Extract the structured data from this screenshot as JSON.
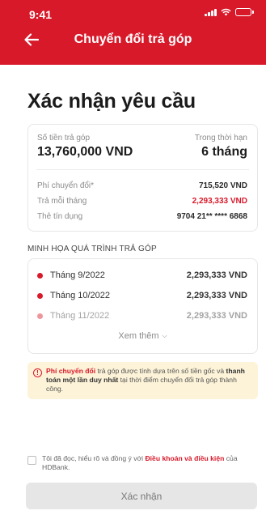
{
  "status_bar": {
    "time": "9:41"
  },
  "header": {
    "title": "Chuyển đổi trả góp"
  },
  "page_title": "Xác nhận yêu cầu",
  "summary": {
    "amount_label": "Số tiền trả góp",
    "amount_value": "13,760,000 VND",
    "term_label": "Trong thời hạn",
    "term_value": "6 tháng",
    "rows": [
      {
        "label": "Phí chuyển đổi*",
        "value": "715,520 VND",
        "highlight": false
      },
      {
        "label": "Trả mỗi tháng",
        "value": "2,293,333 VND",
        "highlight": true
      },
      {
        "label": "Thẻ tín dụng",
        "value": "9704 21** **** 6868",
        "highlight": false
      }
    ]
  },
  "plan": {
    "section_title": "MINH HỌA QUÁ TRÌNH TRẢ GÓP",
    "items": [
      {
        "month": "Tháng 9/2022",
        "amount": "2,293,333 VND"
      },
      {
        "month": "Tháng 10/2022",
        "amount": "2,293,333 VND"
      },
      {
        "month": "Tháng 11/2022",
        "amount": "2,293,333 VND"
      }
    ],
    "see_more": "Xem thêm"
  },
  "notice": {
    "bold1": "Phí chuyển đổi",
    "text1": " trả góp được tính dựa trên số tiền gốc và ",
    "bold2": "thanh toán một lần duy nhất",
    "text2": " tại thời điểm chuyển đổi trả góp thành công."
  },
  "agreement": {
    "prefix": "Tôi đã đọc, hiểu rõ và đồng ý với ",
    "link": "Điều khoản và điều kiện",
    "suffix": " của HDBank."
  },
  "confirm_label": "Xác nhận",
  "colors": {
    "brand": "#d8192a",
    "notice_bg": "#fdf3d8",
    "button_disabled": "#e6e6e6"
  },
  "icons": {
    "back": "arrow-left-icon",
    "info": "info-icon",
    "expand": "chevron-down-icon"
  }
}
